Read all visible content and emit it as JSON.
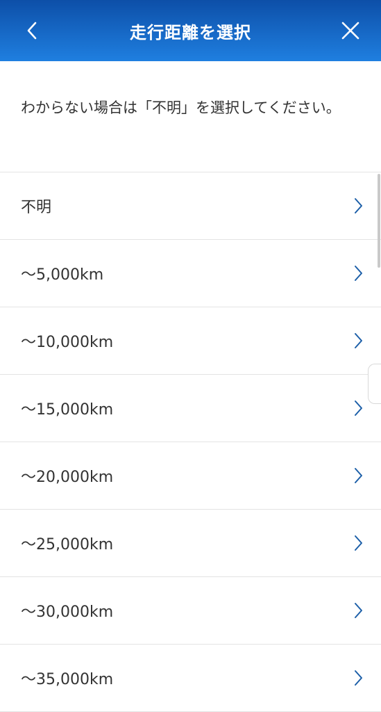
{
  "header": {
    "title": "走行距離を選択",
    "back_icon": "chevron-left-icon",
    "close_icon": "close-icon"
  },
  "notice": {
    "text": "わからない場合は「不明」を選択してください。"
  },
  "options": [
    {
      "label": "不明"
    },
    {
      "label": "〜5,000km"
    },
    {
      "label": "〜10,000km"
    },
    {
      "label": "〜15,000km"
    },
    {
      "label": "〜20,000km"
    },
    {
      "label": "〜25,000km"
    },
    {
      "label": "〜30,000km"
    },
    {
      "label": "〜35,000km"
    }
  ],
  "colors": {
    "header_top": "#0d4fa8",
    "header_bottom": "#1f7fe0",
    "chevron": "#1c5fa8",
    "divider": "#e3e3e3"
  }
}
